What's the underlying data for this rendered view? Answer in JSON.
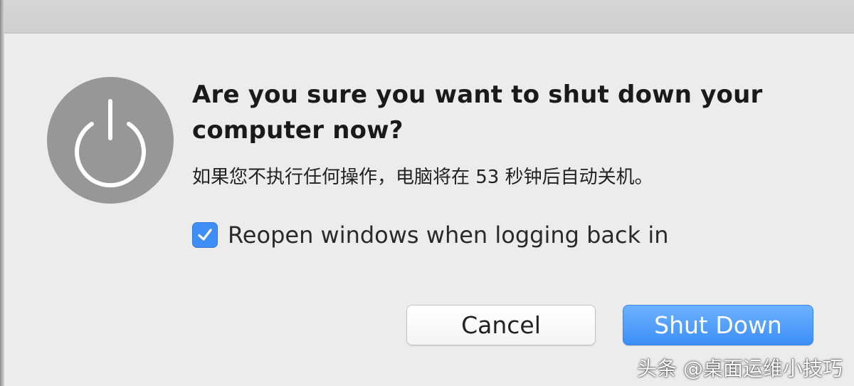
{
  "dialog": {
    "icon": "power-icon",
    "title": "Are you sure you want to shut down your computer now?",
    "message": "如果您不执行任何操作，电脑将在 53 秒钟后自动关机。",
    "checkbox": {
      "label": "Reopen windows when logging back in",
      "checked": true
    },
    "buttons": {
      "cancel": "Cancel",
      "shutdown": "Shut Down"
    }
  },
  "watermark": "头条 @桌面运维小技巧",
  "colors": {
    "accent": "#3c8ef7",
    "icon_bg": "#979797",
    "background": "#ececec"
  }
}
